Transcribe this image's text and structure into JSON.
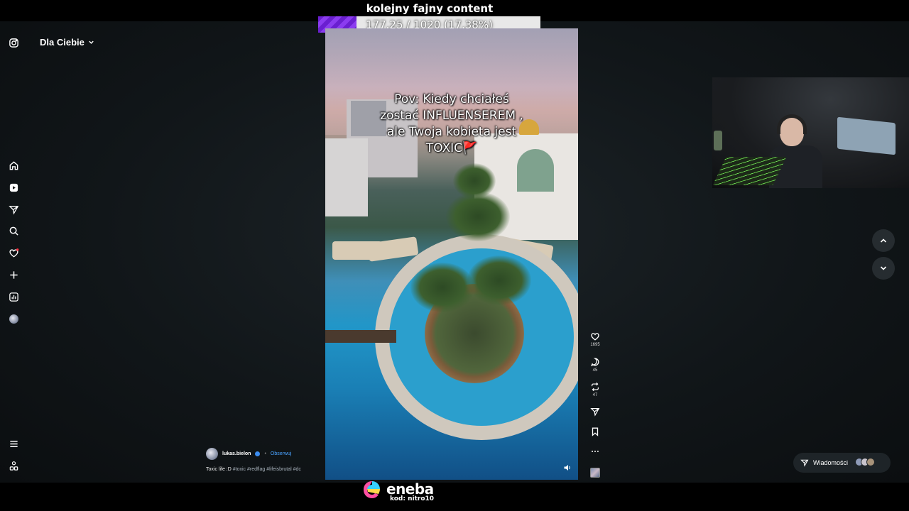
{
  "overlay": {
    "title": "kolejny fajny content",
    "goal_text": "177.25 / 1020 (17.38%)",
    "goal_progress": 0.1738,
    "goal_color": "#7b2fe0"
  },
  "sidebar": {
    "feed_label": "Dla Ciebie",
    "icons": [
      "instagram-icon",
      "home-icon",
      "reels-icon",
      "send-icon",
      "search-icon",
      "heart-icon",
      "plus-icon",
      "stats-icon",
      "profile-avatar",
      "menu-icon",
      "more-icon"
    ]
  },
  "video": {
    "caption_lines": [
      "Pov: Kiedy chciałeś",
      "zostać INFLUENSEREM ,",
      "ale Twoja kobieta jest",
      "TOXIC🚩"
    ]
  },
  "actions": {
    "likes": "1695",
    "comments": "45",
    "reposts": "47"
  },
  "author": {
    "username": "lukas.bielon",
    "follow_label": "Obserwuj",
    "description": "Toxic life :D",
    "hashtags": "#toxic #redflag #lifeisbrutal #dc"
  },
  "messages": {
    "label": "Wiadomości"
  },
  "sponsor": {
    "name": "eneba",
    "code": "kod: nitro10"
  }
}
